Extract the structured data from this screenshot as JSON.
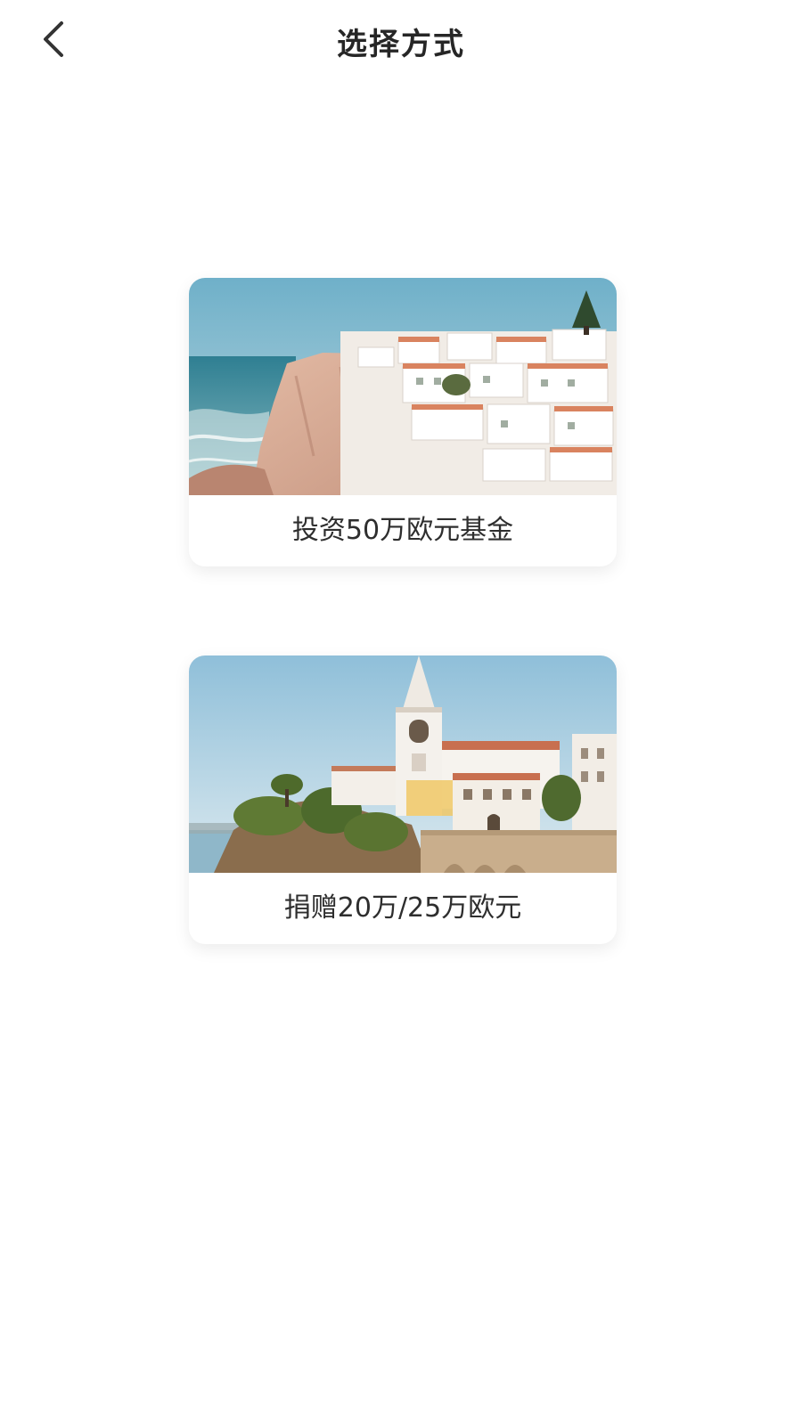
{
  "header": {
    "title": "选择方式",
    "back_icon": "chevron-left-icon"
  },
  "options": [
    {
      "label": "投资50万欧元基金",
      "image": "coastal-white-town-cliff-photo"
    },
    {
      "label": "捐赠20万/25万欧元",
      "image": "church-tower-coastal-fortress-photo"
    }
  ],
  "colors": {
    "background": "#ffffff",
    "text": "#2b2b2b"
  }
}
